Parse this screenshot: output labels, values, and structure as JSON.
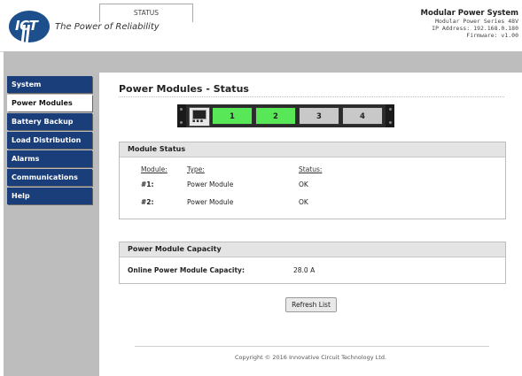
{
  "header": {
    "logo_text": "ICT",
    "tagline": "The Power of Reliability",
    "system_title": "Modular Power System",
    "system_series": "Modular Power Series 48V",
    "ip_address": "IP Address: 192.168.0.180",
    "firmware": "Firmware: v1.00"
  },
  "tabs": [
    {
      "label": "STATUS",
      "active": true
    }
  ],
  "sidebar": {
    "items": [
      {
        "label": "System",
        "active": false
      },
      {
        "label": "Power Modules",
        "active": true
      },
      {
        "label": "Battery Backup",
        "active": false
      },
      {
        "label": "Load Distribution",
        "active": false
      },
      {
        "label": "Alarms",
        "active": false
      },
      {
        "label": "Communications",
        "active": false
      },
      {
        "label": "Help",
        "active": false
      }
    ]
  },
  "page": {
    "title": "Power Modules - Status"
  },
  "rack": {
    "slots": [
      {
        "label": "1",
        "color": "#57e757"
      },
      {
        "label": "2",
        "color": "#57e757"
      },
      {
        "label": "3",
        "color": "#c8c8c8"
      },
      {
        "label": "4",
        "color": "#c8c8c8"
      }
    ]
  },
  "module_status": {
    "heading": "Module Status",
    "col_module": "Module:",
    "col_type": "Type:",
    "col_status": "Status:",
    "rows": [
      {
        "module": "#1:",
        "type": "Power Module",
        "status": "OK"
      },
      {
        "module": "#2:",
        "type": "Power Module",
        "status": "OK"
      }
    ]
  },
  "capacity": {
    "heading": "Power Module Capacity",
    "label": "Online Power Module Capacity:",
    "value": "28.0 A"
  },
  "refresh_label": "Refresh List",
  "footer": "Copyright © 2016 Innovative Circuit Technology Ltd.",
  "colors": {
    "nav_bg": "#1a3e7a",
    "module_on": "#57e757",
    "module_off": "#c8c8c8"
  }
}
